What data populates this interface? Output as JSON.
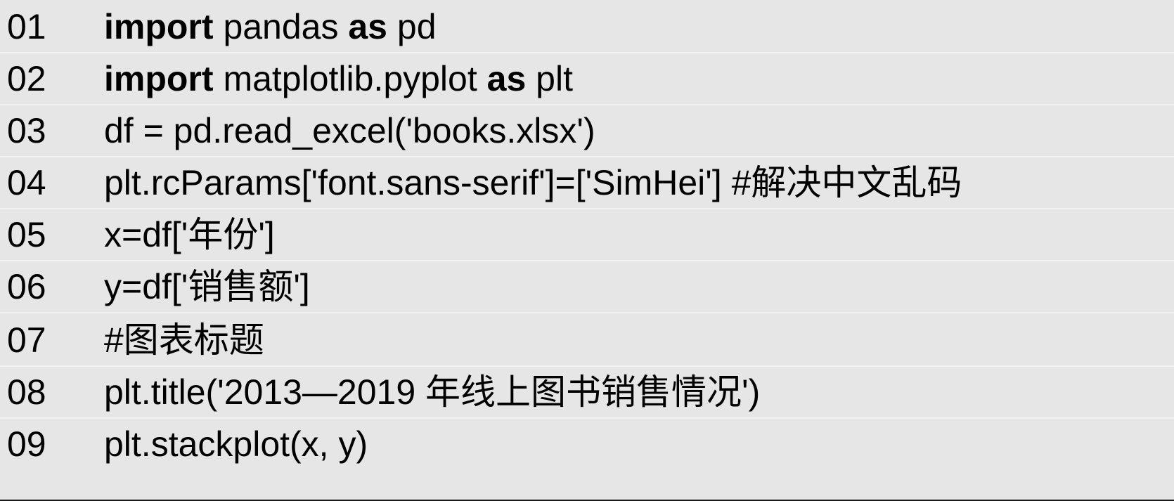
{
  "lines": [
    {
      "number": "01",
      "tokens": [
        {
          "text": "import",
          "kw": true
        },
        {
          "text": " pandas ",
          "kw": false
        },
        {
          "text": "as",
          "kw": true
        },
        {
          "text": " pd",
          "kw": false
        }
      ]
    },
    {
      "number": "02",
      "tokens": [
        {
          "text": "import",
          "kw": true
        },
        {
          "text": " matplotlib.pyplot ",
          "kw": false
        },
        {
          "text": "as",
          "kw": true
        },
        {
          "text": " plt",
          "kw": false
        }
      ]
    },
    {
      "number": "03",
      "tokens": [
        {
          "text": "df = pd.read_excel('books.xlsx')",
          "kw": false
        }
      ]
    },
    {
      "number": "04",
      "tokens": [
        {
          "text": "plt.rcParams['font.sans-serif']=['SimHei'] #解决中文乱码",
          "kw": false
        }
      ]
    },
    {
      "number": "05",
      "tokens": [
        {
          "text": "x=df['年份']",
          "kw": false
        }
      ]
    },
    {
      "number": "06",
      "tokens": [
        {
          "text": "y=df['销售额']",
          "kw": false
        }
      ]
    },
    {
      "number": "07",
      "tokens": [
        {
          "text": "#图表标题",
          "kw": false
        }
      ]
    },
    {
      "number": "08",
      "tokens": [
        {
          "text": "plt.title('2013—2019 年线上图书销售情况')",
          "kw": false
        }
      ]
    },
    {
      "number": "09",
      "tokens": [
        {
          "text": "plt.stackplot(x, y)",
          "kw": false
        }
      ]
    }
  ]
}
